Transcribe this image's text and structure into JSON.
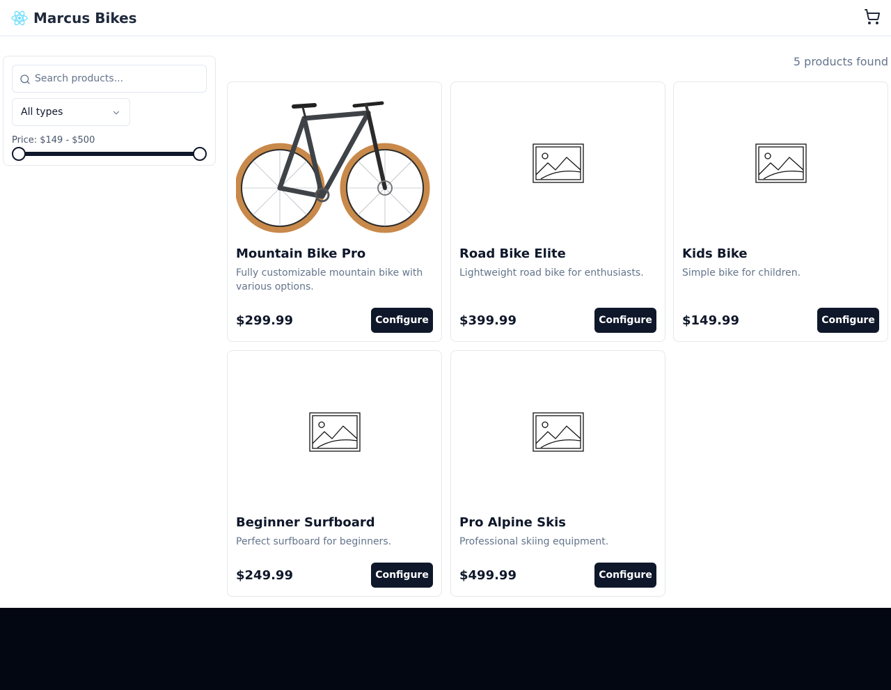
{
  "header": {
    "brand": "Marcus Bikes"
  },
  "filters": {
    "search_placeholder": "Search products...",
    "type_selected": "All types",
    "price_label": "Price: $149 - $500",
    "price_min": 149,
    "price_max": 500
  },
  "results": {
    "count_text": "5 products found",
    "products": [
      {
        "name": "Mountain Bike Pro",
        "description": "Fully customizable mountain bike with various options.",
        "price": "$299.99",
        "button": "Configure",
        "image": "bicycle-photo"
      },
      {
        "name": "Road Bike Elite",
        "description": "Lightweight road bike for enthusiasts.",
        "price": "$399.99",
        "button": "Configure",
        "image": "image-placeholder-icon"
      },
      {
        "name": "Kids Bike",
        "description": "Simple bike for children.",
        "price": "$149.99",
        "button": "Configure",
        "image": "image-placeholder-icon"
      },
      {
        "name": "Beginner Surfboard",
        "description": "Perfect surfboard for beginners.",
        "price": "$249.99",
        "button": "Configure",
        "image": "image-placeholder-icon"
      },
      {
        "name": "Pro Alpine Skis",
        "description": "Professional skiing equipment.",
        "price": "$499.99",
        "button": "Configure",
        "image": "image-placeholder-icon"
      }
    ]
  },
  "colors": {
    "primary": "#0f172a",
    "muted_text": "#64748b",
    "border": "#e5e7eb",
    "footer": "#030712",
    "logo": "#61dafb"
  }
}
